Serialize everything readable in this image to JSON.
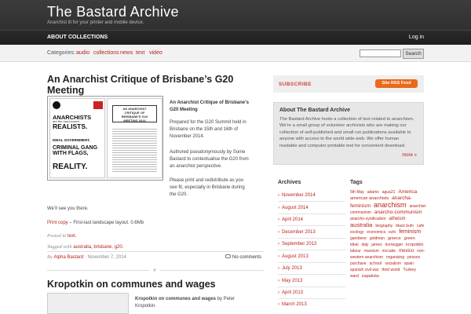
{
  "header": {
    "title": "The Bastard Archive",
    "tagline": "Anarchist lit for your printer and mobile device.",
    "nav": [
      "ABOUT",
      "COLLECTIONS"
    ],
    "login": "Log in"
  },
  "catbar": {
    "label": "Categories:",
    "items": [
      "audio",
      "collections",
      "news",
      "text",
      "video"
    ],
    "search_button": "Search"
  },
  "post1": {
    "title": "An Anarchist Critique of Brisbane’s G20 Meeting",
    "pamphlet_cover": [
      "AN ANARCHIST",
      "CRITIQUE OF",
      "BRISBANE'S G20",
      "MEETING 2014"
    ],
    "pamphlet_words": [
      "ANARCHISTS",
      "are the hard-nosed",
      "REALISTS.",
      "IDEAL GOVERNMENT,",
      "CRIMINAL GANG",
      "WITH FLAGS,",
      "REALITY."
    ],
    "intro_title": "An Anarchist Critique of Brisbane’s G20 Meeting",
    "p1": "Prepared for the G20 Summit held in Brisbane on the 15th and 16th of November 2014.",
    "p2": "Authored pseudonymously by Some Bastard to contextualise the G20 from an anarchist perspective.",
    "p3": "Please print and redistribute as you see fit, especially in Brisbane during the G20.",
    "p4": "We’ll see you there.",
    "printcopy": "Print copy",
    "printcopy_rest": " – First-last landscape layout. 0.6Mb",
    "posted_in": "Posted in",
    "posted_cat": "text.",
    "tagged_with": "Tagged with",
    "tags": "australia, brisbane, g20.",
    "by": "By",
    "author": "Alpha Bastard",
    "date": " · November 7, 2014",
    "comments": "No comments"
  },
  "post2": {
    "title": "Kropotkin on communes and wages",
    "intro_title": "Kropotkin on communes and wages",
    "intro_by": " by Peter",
    "intro_author": "Kropotkin."
  },
  "sidebar": {
    "subscribe": "SUBSCRIBE",
    "rss": "Site RSS Feed",
    "about_title": "About The Bastard Archive",
    "about_text": "The Bastard Archive hosts a collection of text related to anarchism. We’re a small group of volunteer archivists who are making our collection of self-published and small run publications available to anyone with access to the world wide web. We offer human readable and computer printable text for convenient download.",
    "more": "more »",
    "archives_title": "Archives",
    "archives": [
      "November 2014",
      "August 2014",
      "April 2014",
      "December 2013",
      "September 2013",
      "August 2013",
      "July 2013",
      "May 2013",
      "April 2013",
      "March 2013"
    ],
    "tags_title": "Tags",
    "tag_cloud": [
      "5th May",
      "adams",
      "agua21",
      "America",
      "american anarchists",
      "anarcha-feminism",
      "anarchism",
      "anarchist-communism",
      "anarcho-communism",
      "anarcho-syndicalism",
      "atheism",
      "australia",
      "biography",
      "black bufo",
      "cafe",
      "ecology",
      "economics",
      "ezln",
      "feminism",
      "gambene",
      "goldman",
      "greece",
      "green",
      "ideal",
      "italy",
      "james",
      "kornegger",
      "kropotkin",
      "labour",
      "marxism",
      "mccabe",
      "mexico",
      "non-western anarchism",
      "organising",
      "prisons",
      "purchase",
      "school",
      "socialism",
      "spain",
      "spanish civil war",
      "third world",
      "Turkey",
      "ward",
      "zapatista"
    ]
  }
}
